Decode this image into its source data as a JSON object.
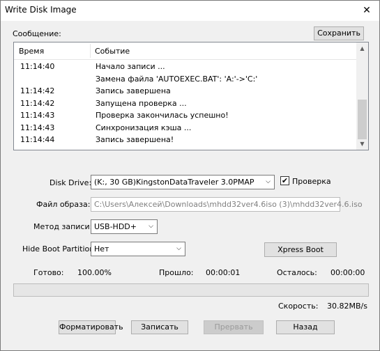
{
  "window": {
    "title": "Write Disk Image",
    "close_glyph": "✕"
  },
  "message_label": "Сообщение:",
  "save_button": "Сохранить",
  "log": {
    "columns": {
      "time": "Время",
      "event": "Событие"
    },
    "rows": [
      {
        "time": "11:14:40",
        "event": "Начало записи ..."
      },
      {
        "time": "",
        "event": "Замена файла 'AUTOEXEC.BAT': 'A:'->'C:'"
      },
      {
        "time": "11:14:42",
        "event": "Запись завершена"
      },
      {
        "time": "11:14:42",
        "event": "Запущена проверка ..."
      },
      {
        "time": "11:14:43",
        "event": "Проверка закончилась успешно!"
      },
      {
        "time": "11:14:43",
        "event": "Синхронизация кэша ..."
      },
      {
        "time": "11:14:44",
        "event": "Запись завершена!"
      }
    ],
    "scroll_up_glyph": "▲",
    "scroll_down_glyph": "▼"
  },
  "disk_drive": {
    "label": "Disk Drive:",
    "value": "(K:, 30 GB)KingstonDataTraveler 3.0PMAP"
  },
  "verify": {
    "label": "Проверка",
    "checked": true,
    "check_glyph": "✔"
  },
  "image_file": {
    "label": "Файл образа:",
    "value": "C:\\Users\\Алексей\\Downloads\\mhdd32ver4.6iso (3)\\mhdd32ver4.6.iso"
  },
  "write_method": {
    "label": "Метод записи:",
    "value": "USB-HDD+"
  },
  "hide_boot": {
    "label": "Hide Boot Partition:",
    "value": "Нет"
  },
  "xpress_boot_button": "Xpress Boot",
  "dropdown_glyph": "⌵",
  "status": {
    "done_label": "Готово:",
    "done_value": "100.00%",
    "elapsed_label": "Прошло:",
    "elapsed_value": "00:00:01",
    "remaining_label": "Осталось:",
    "remaining_value": "00:00:00",
    "speed_label": "Скорость:",
    "speed_value": "30.82MB/s"
  },
  "progress": {
    "fraction": 0.0
  },
  "buttons": {
    "format": "Форматировать",
    "write": "Записать",
    "abort": "Прервать",
    "back": "Назад"
  }
}
